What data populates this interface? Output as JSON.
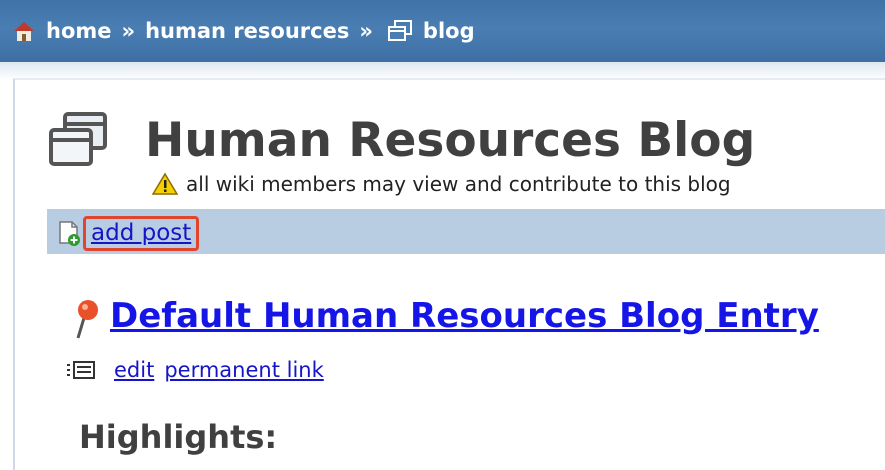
{
  "breadcrumb": {
    "home": "home",
    "section": "human resources",
    "current": "blog",
    "separator": "»"
  },
  "page": {
    "title": "Human Resources Blog",
    "notice": "all wiki members may view and contribute to this blog"
  },
  "toolbar": {
    "add_post_label": "add post"
  },
  "post": {
    "title": "Default Human Resources Blog Entry",
    "edit_label": "edit",
    "permalink_label": "permanent link",
    "highlights_heading": "Highlights:"
  },
  "icons": {
    "home": "house-icon",
    "blog": "blog-windows-icon",
    "warning": "warning-icon",
    "new_post": "new-document-icon",
    "post_marker": "pushpin-icon",
    "post_tools": "list-icon"
  },
  "colors": {
    "header_bar": "#4a7eb3",
    "toolbar": "#b8cde2",
    "link": "#1515c8",
    "highlight_box": "#e2452d",
    "title_text": "#404040"
  }
}
